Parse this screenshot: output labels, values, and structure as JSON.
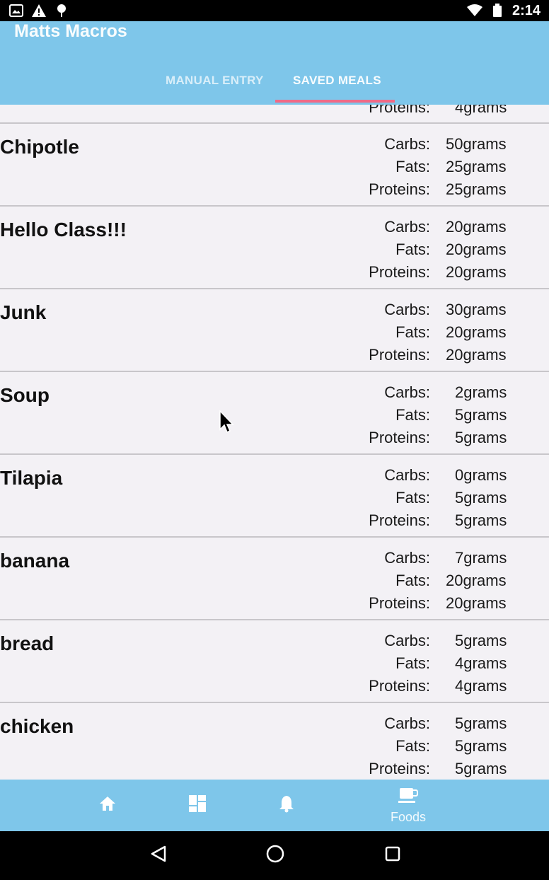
{
  "status_bar": {
    "time": "2:14",
    "icons_left": [
      "gallery-icon",
      "warning-icon",
      "location-pin-icon"
    ],
    "icons_right": [
      "wifi-icon",
      "battery-icon"
    ]
  },
  "header": {
    "title": "Matts Macros",
    "tabs": [
      {
        "label": "MANUAL ENTRY",
        "active": false
      },
      {
        "label": "SAVED MEALS",
        "active": true
      }
    ],
    "colors": {
      "background": "#7ec6ea",
      "indicator": "#f06a86"
    }
  },
  "partial_meal": {
    "proteins_label": "Proteins:",
    "proteins_value": "4grams"
  },
  "meals": [
    {
      "name": "Chipotle",
      "labels": [
        "Carbs:",
        "Fats:",
        "Proteins:"
      ],
      "values": [
        "50grams",
        "25grams",
        "25grams"
      ]
    },
    {
      "name": "Hello Class!!!",
      "labels": [
        "Carbs:",
        "Fats:",
        "Proteins:"
      ],
      "values": [
        "20grams",
        "20grams",
        "20grams"
      ]
    },
    {
      "name": "Junk",
      "labels": [
        "Carbs:",
        "Fats:",
        "Proteins:"
      ],
      "values": [
        "30grams",
        "20grams",
        "20grams"
      ]
    },
    {
      "name": "Soup",
      "labels": [
        "Carbs:",
        "Fats:",
        "Proteins:"
      ],
      "values": [
        "2grams",
        "5grams",
        "5grams"
      ]
    },
    {
      "name": "Tilapia",
      "labels": [
        "Carbs:",
        "Fats:",
        "Proteins:"
      ],
      "values": [
        "0grams",
        "5grams",
        "5grams"
      ]
    },
    {
      "name": "banana",
      "labels": [
        "Carbs:",
        "Fats:",
        "Proteins:"
      ],
      "values": [
        "7grams",
        "20grams",
        "20grams"
      ]
    },
    {
      "name": "bread",
      "labels": [
        "Carbs:",
        "Fats:",
        "Proteins:"
      ],
      "values": [
        "5grams",
        "4grams",
        "4grams"
      ]
    },
    {
      "name": "chicken",
      "labels": [
        "Carbs:",
        "Fats:",
        "Proteins:"
      ],
      "values": [
        "5grams",
        "5grams",
        "5grams"
      ]
    }
  ],
  "bottom_nav": {
    "items": [
      {
        "icon": "home-icon",
        "label": ""
      },
      {
        "icon": "dashboard-icon",
        "label": ""
      },
      {
        "icon": "bell-icon",
        "label": ""
      },
      {
        "icon": "coffee-cup-icon",
        "label": "Foods"
      }
    ]
  },
  "system_nav": [
    "back-icon",
    "home-circle-icon",
    "recents-icon"
  ]
}
